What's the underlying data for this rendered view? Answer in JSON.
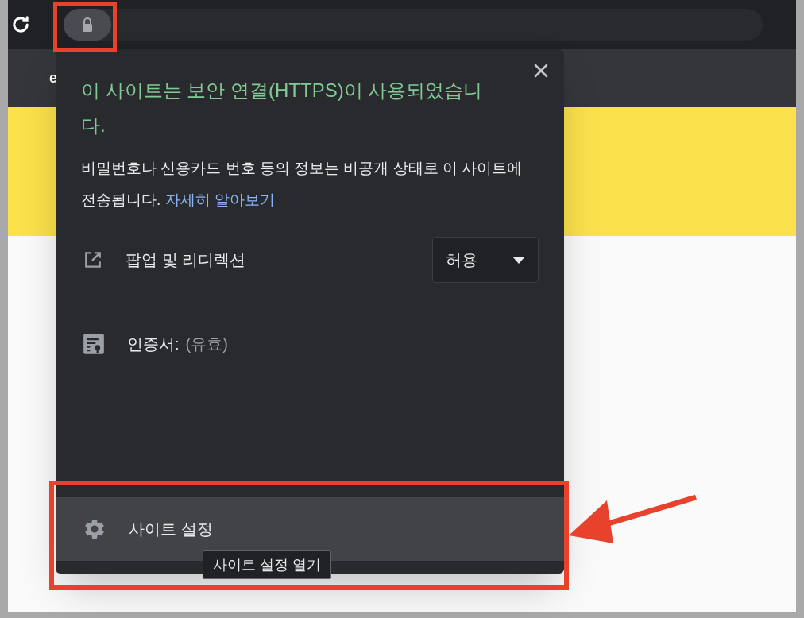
{
  "browser": {
    "tab_label": "e"
  },
  "popup": {
    "title": "이 사이트는 보안 연결(HTTPS)이 사용되었습니다.",
    "description": "비밀번호나 신용카드 번호 등의 정보는 비공개 상태로 이 사이트에 전송됩니다.",
    "learn_more_link": "자세히 알아보기",
    "permissions": [
      {
        "label": "팝업 및 리디렉션",
        "value": "허용"
      }
    ],
    "certificate": {
      "label": "인증서:",
      "status": "(유효)"
    },
    "site_settings": {
      "label": "사이트 설정",
      "hovered": true
    },
    "tooltip": "사이트 설정 열기"
  }
}
